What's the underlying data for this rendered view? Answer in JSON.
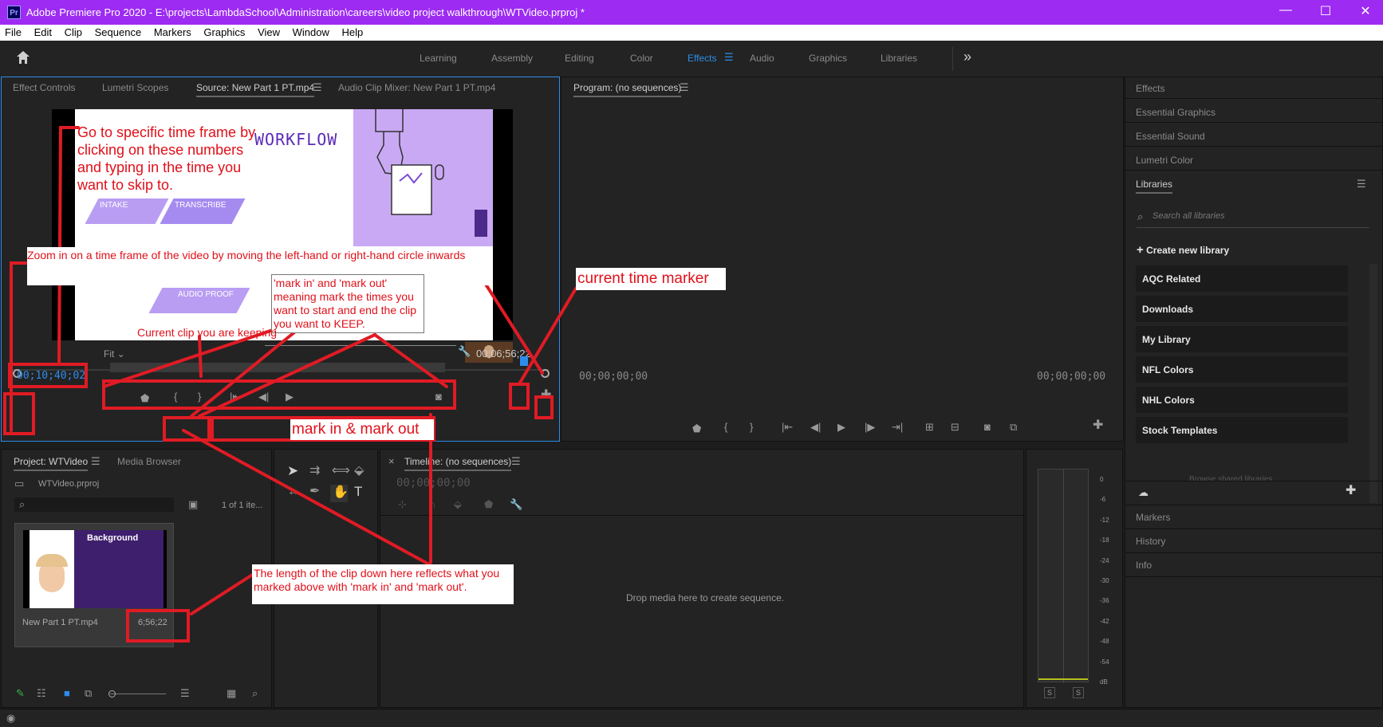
{
  "window": {
    "title": "Adobe Premiere Pro 2020 - E:\\projects\\LambdaSchool\\Administration\\careers\\video project walkthrough\\WTVideo.prproj *",
    "app_icon": "Pr",
    "controls": {
      "minimize": "—",
      "maximize": "☐",
      "close": "✕"
    }
  },
  "menu": [
    "File",
    "Edit",
    "Clip",
    "Sequence",
    "Markers",
    "Graphics",
    "View",
    "Window",
    "Help"
  ],
  "workspaces": {
    "tabs": [
      "Learning",
      "Assembly",
      "Editing",
      "Color",
      "Effects",
      "Audio",
      "Graphics",
      "Libraries"
    ],
    "active": "Effects",
    "more": "»"
  },
  "source_panel": {
    "tabs": [
      "Effect Controls",
      "Lumetri Scopes",
      "Source: New Part 1 PT.mp4",
      "Audio Clip Mixer: New Part 1 PT.mp4"
    ],
    "active_tab": "Source: New Part 1 PT.mp4",
    "current_time": "00;10;40;02",
    "duration": "00;06;56;22",
    "fit": "Fit",
    "video": {
      "slide_title": "WORKFLOW",
      "chevrons": [
        "INTAKE",
        "TRANSCRIBE",
        "AUDIO PROOF"
      ]
    }
  },
  "program_panel": {
    "title": "Program: (no sequences)",
    "time_left": "00;00;00;00",
    "time_right": "00;00;00;00"
  },
  "right_panels": {
    "top": [
      "Effects",
      "Essential Graphics",
      "Essential Sound",
      "Lumetri Color"
    ],
    "libraries_title": "Libraries",
    "search_placeholder": "Search all libraries",
    "create_new": "Create new library",
    "items": [
      "AQC Related",
      "Downloads",
      "My Library",
      "NFL Colors",
      "NHL Colors",
      "Stock Templates"
    ],
    "shared": "Browse shared libraries",
    "bottom": [
      "Markers",
      "History",
      "Info"
    ]
  },
  "project_panel": {
    "tabs": [
      "Project: WTVideo",
      "Media Browser"
    ],
    "file": "WTVideo.prproj",
    "count": "1 of 1 ite...",
    "clip_name": "New Part 1 PT.mp4",
    "clip_duration": "6;56;22",
    "thumb_title": "Background"
  },
  "timeline_panel": {
    "title": "Timeline: (no sequences)",
    "time": "00;00;00;00",
    "drop_text": "Drop media here to create sequence."
  },
  "audio_meter": {
    "ticks": [
      "0",
      "-6",
      "-12",
      "-18",
      "-24",
      "-30",
      "-36",
      "-42",
      "-48",
      "-54",
      "dB"
    ],
    "solo": [
      "S",
      "S"
    ]
  },
  "annotations": {
    "goto": "Go to specific time frame by clicking on these numbers and typing in the time you want to skip to.",
    "zoom": "Zoom in on a time frame of the video by moving the left-hand or right-hand circle inwards",
    "markinout_desc": "'mark in' and 'mark out' meaning mark the times you want to start and end the clip you want to KEEP.",
    "current_clip": "Current clip you are keeping",
    "current_time_marker": "current time marker",
    "mark_in_out": "mark in & mark out",
    "length_note": "The length of the clip down here reflects what you marked above with 'mark in' and 'mark out'."
  },
  "colors": {
    "titlebar": "#9d2bf2",
    "accent": "#2d8ceb",
    "annotation": "#e01b24"
  }
}
